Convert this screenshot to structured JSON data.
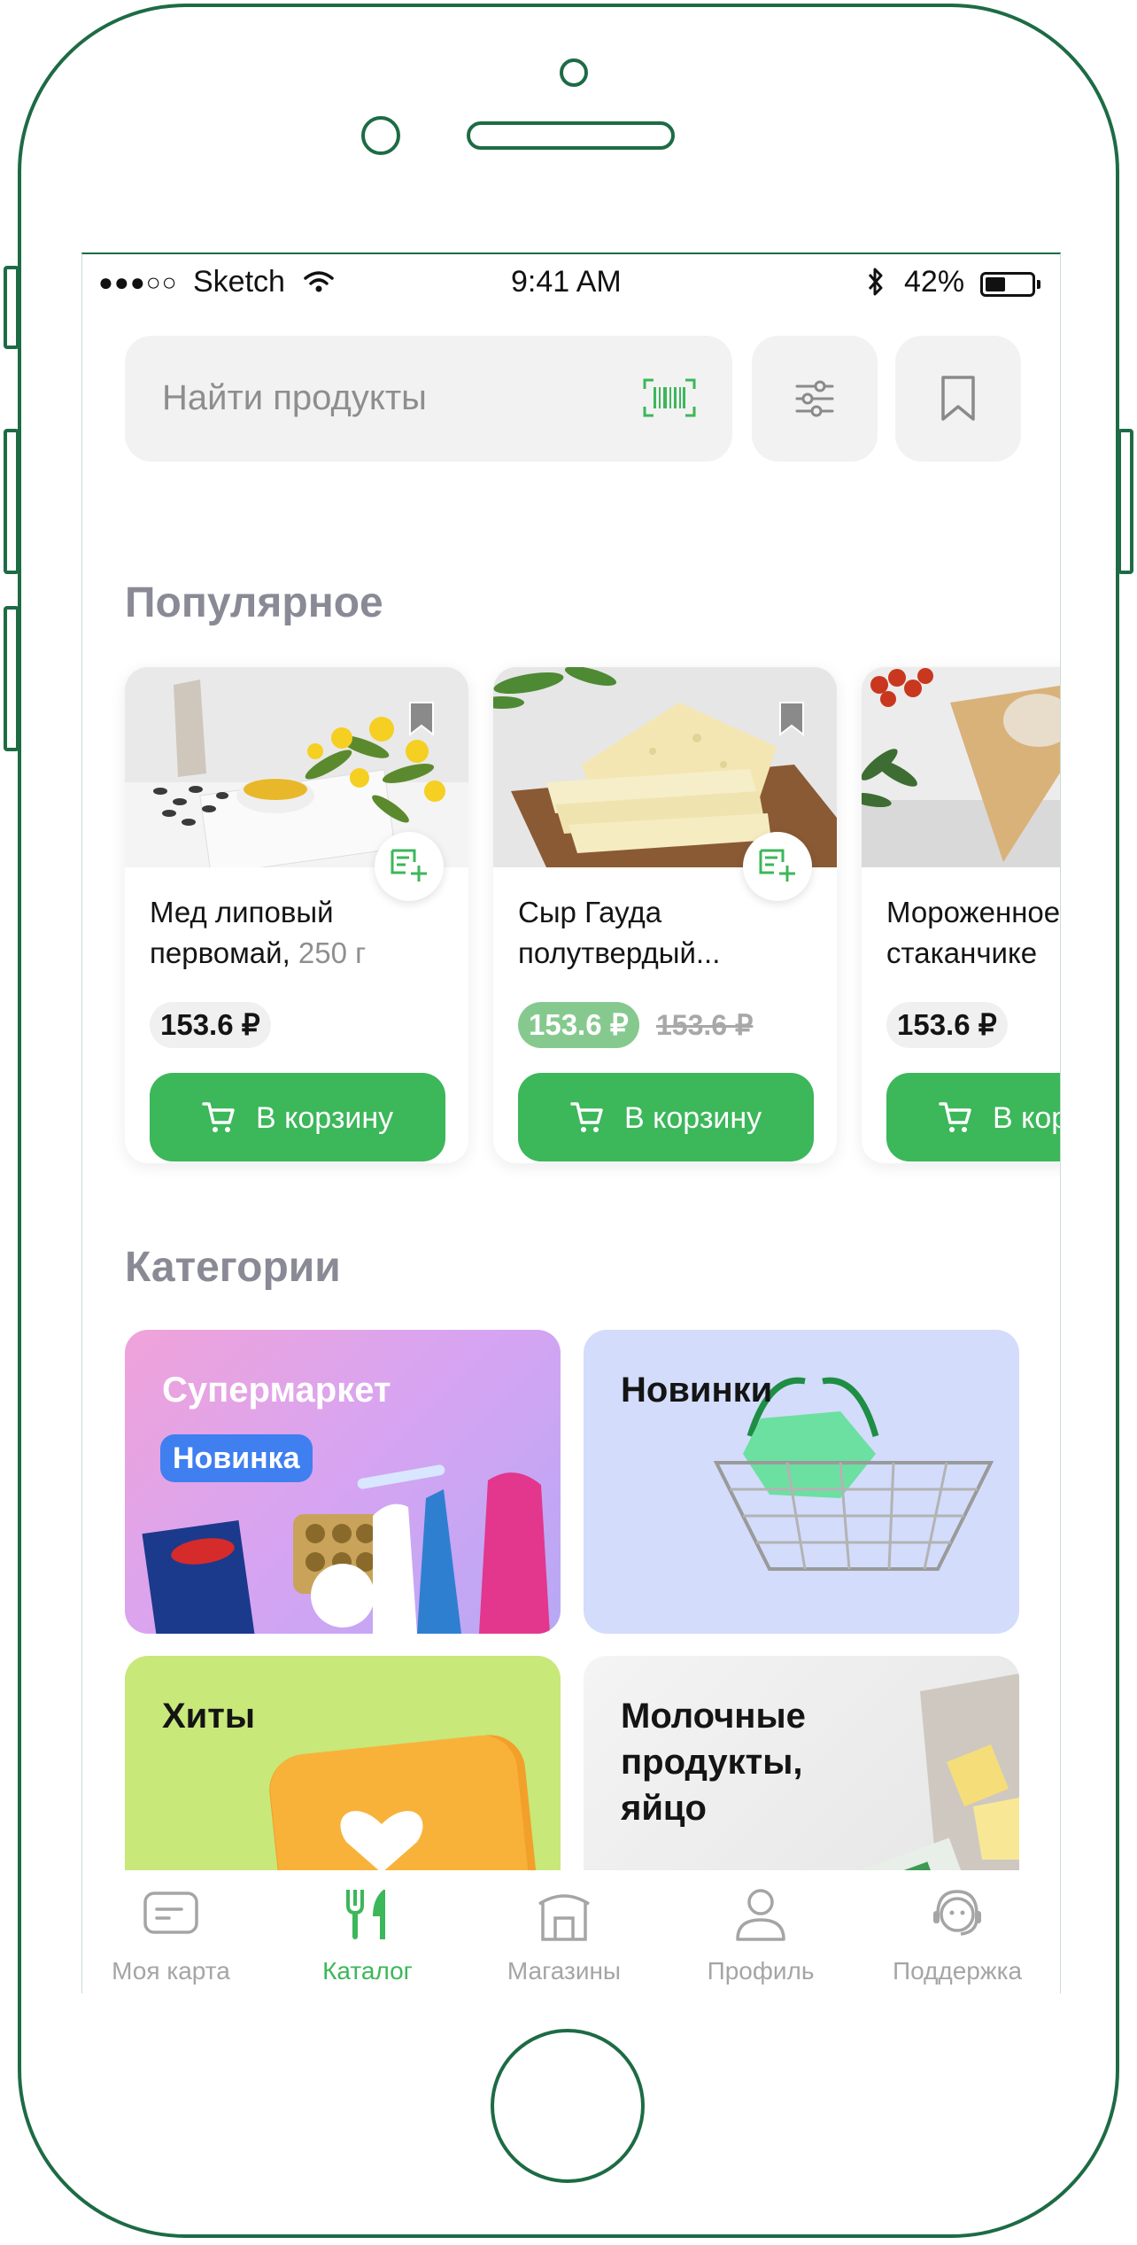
{
  "status_bar": {
    "carrier": "Sketch",
    "time": "9:41 AM",
    "battery": "42%"
  },
  "search": {
    "placeholder": "Найти продукты"
  },
  "popular": {
    "title": "Популярное",
    "products": [
      {
        "name": "Мед липовый первомай,",
        "weight": "250 г",
        "price": "153.6 ₽",
        "old_price": "",
        "button": "В корзину"
      },
      {
        "name": "Сыр Гауда полутвердый...",
        "weight": "",
        "price": "153.6 ₽",
        "old_price": "153.6 ₽",
        "button": "В корзину"
      },
      {
        "name": "Мороженное в стаканчике",
        "weight": "",
        "price": "153.6 ₽",
        "old_price": "",
        "button": "В корзину"
      }
    ]
  },
  "categories": {
    "title": "Категории",
    "tiles": [
      {
        "title": "Супермаркет",
        "badge": "Новинка",
        "color": "#d7a6ee"
      },
      {
        "title": "Новинки",
        "color": "#d3dcfb"
      },
      {
        "title": "Хиты",
        "color": "#c8e87a"
      },
      {
        "title": "Молочные продукты, яйцо",
        "color": "#ececec"
      }
    ]
  },
  "tabbar": {
    "items": [
      {
        "label": "Моя карта",
        "icon": "card-icon",
        "active": false
      },
      {
        "label": "Каталог",
        "icon": "fork-knife-icon",
        "active": true
      },
      {
        "label": "Магазины",
        "icon": "store-icon",
        "active": false
      },
      {
        "label": "Профиль",
        "icon": "profile-icon",
        "active": false
      },
      {
        "label": "Поддержка",
        "icon": "support-icon",
        "active": false
      }
    ]
  },
  "colors": {
    "accent": "#3cb75a",
    "frame": "#1d6b45",
    "badge": "#3f7ff0"
  }
}
